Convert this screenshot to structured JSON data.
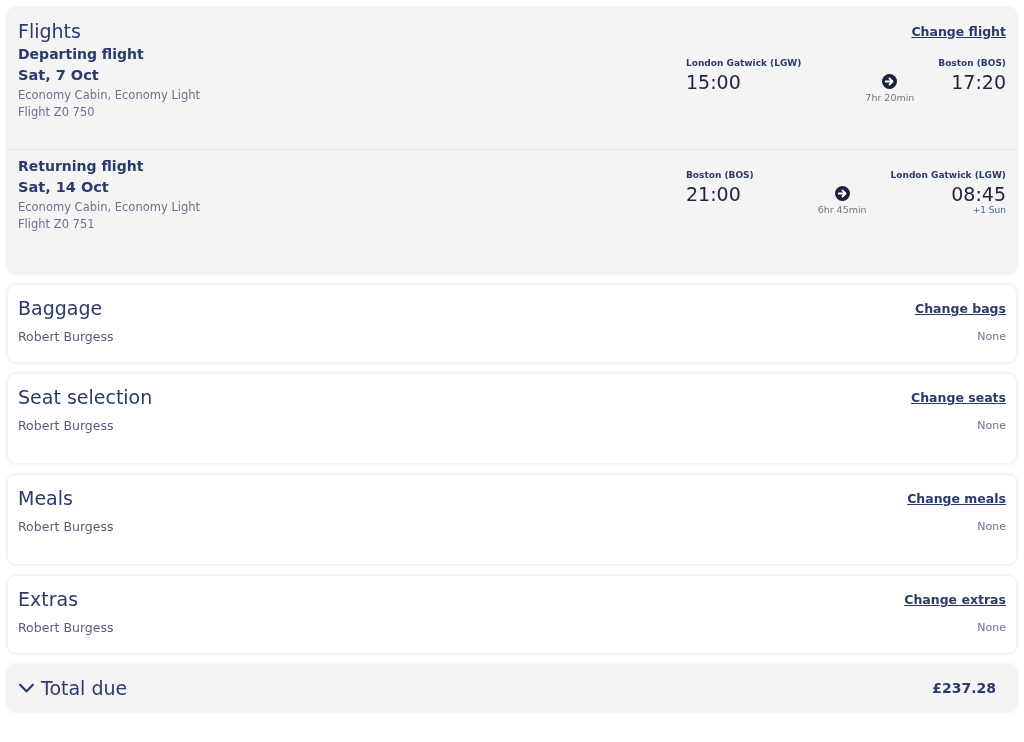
{
  "flights": {
    "title": "Flights",
    "change_link": "Change flight",
    "segments": [
      {
        "label": "Departing flight",
        "date": "Sat, 7 Oct",
        "cabin": "Economy Cabin, Economy Light",
        "flight_number": "Flight Z0 750",
        "from": "London Gatwick (LGW)",
        "depart": "15:00",
        "duration": "7hr 20min",
        "to": "Boston (BOS)",
        "arrive": "17:20"
      },
      {
        "label": "Returning flight",
        "date": "Sat, 14 Oct",
        "cabin": "Economy Cabin, Economy Light",
        "flight_number": "Flight Z0 751",
        "from": "Boston (BOS)",
        "depart": "21:00",
        "duration": "6hr 45min",
        "to": "London Gatwick (LGW)",
        "arrive": "08:45",
        "day_offset": "+1 Sun"
      }
    ]
  },
  "sections": [
    {
      "title": "Baggage",
      "change_link": "Change bags",
      "passenger": "Robert Burgess",
      "value": "None"
    },
    {
      "title": "Seat selection",
      "change_link": "Change seats",
      "passenger": "Robert Burgess",
      "value": "None"
    },
    {
      "title": "Meals",
      "change_link": "Change meals",
      "passenger": "Robert Burgess",
      "value": "None"
    },
    {
      "title": "Extras",
      "change_link": "Change extras",
      "passenger": "Robert Burgess",
      "value": "None"
    }
  ],
  "total": {
    "label": "Total due",
    "amount": "£237.28",
    "expanded": false
  }
}
